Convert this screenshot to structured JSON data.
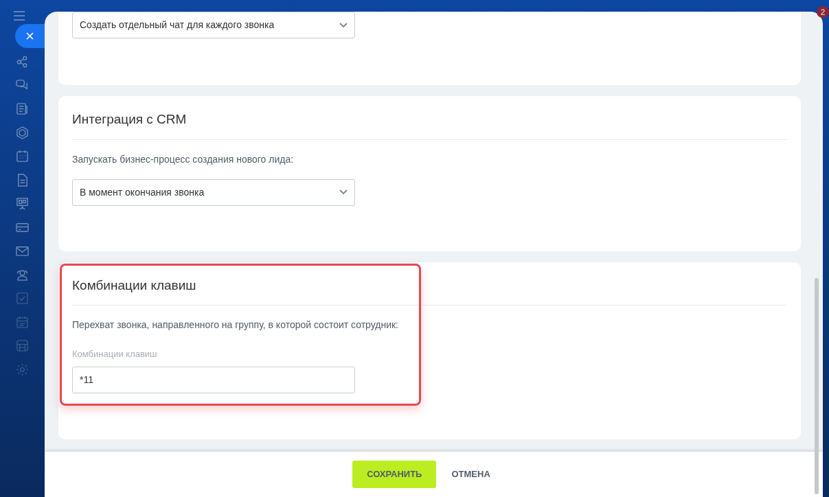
{
  "notification_badge": "2",
  "sections": [
    {
      "kind": "select",
      "value": "Создать отдельный чат для каждого звонка",
      "highlighted": false
    },
    {
      "title": "Интеграция с CRM",
      "label": "Запускать бизнес-процесс создания нового лида:",
      "kind": "select",
      "value": "В момент окончания звонка",
      "highlighted": false
    },
    {
      "title": "Комбинации клавиш",
      "label": "Перехват звонка, направленного на группу, в которой состоит сотрудник:",
      "kind": "input",
      "field_label": "Комбинации клавиш",
      "value": "*11",
      "highlighted": true
    }
  ],
  "buttons": [
    {
      "label": "СОХРАНИТЬ",
      "kind": "primary"
    },
    {
      "label": "ОТМЕНА",
      "kind": "link"
    }
  ]
}
